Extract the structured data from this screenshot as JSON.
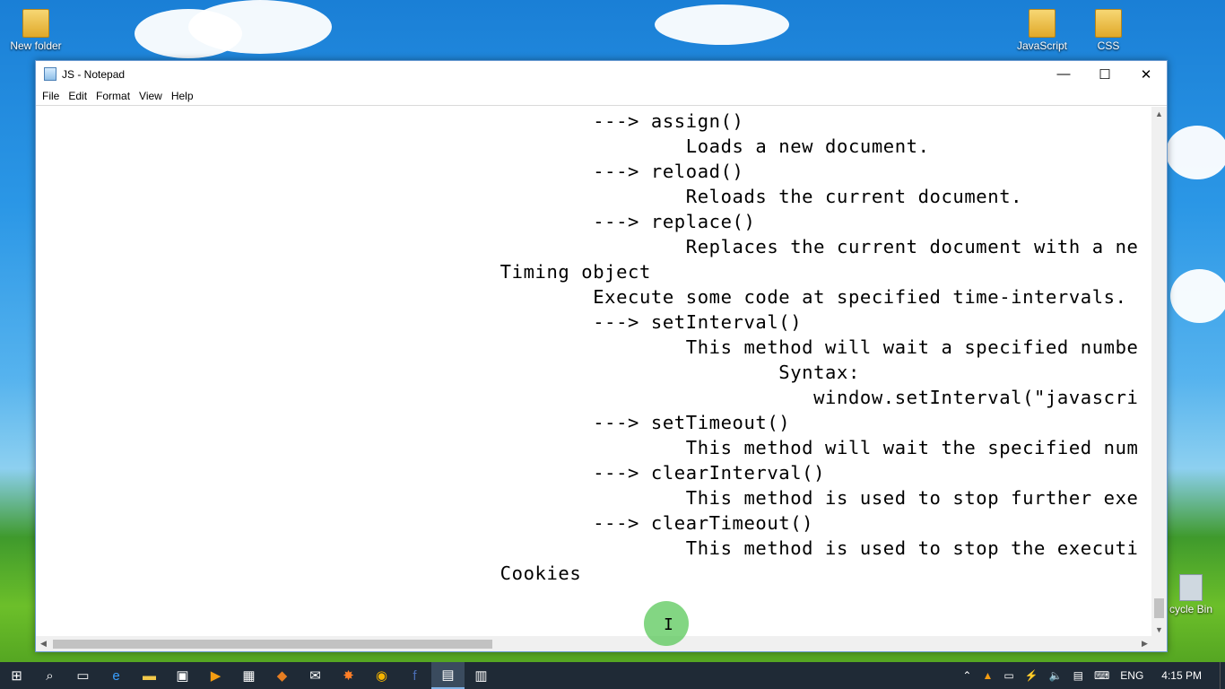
{
  "desktop": {
    "icons": [
      {
        "label": "New folder"
      },
      {
        "label": "JavaScript"
      },
      {
        "label": "CSS"
      },
      {
        "label": "cycle Bin"
      }
    ]
  },
  "window": {
    "title": "JS - Notepad",
    "minimize": "—",
    "maximize": "☐",
    "close": "✕"
  },
  "menu": {
    "file": "File",
    "edit": "Edit",
    "format": "Format",
    "view": "View",
    "help": "Help"
  },
  "editor": {
    "lines": [
      "                                                ---> assign()",
      "                                                        Loads a new document.",
      "                                                ---> reload()",
      "                                                        Reloads the current document.",
      "                                                ---> replace()",
      "                                                        Replaces the current document with a ne",
      "                                        Timing object",
      "                                                Execute some code at specified time-intervals.",
      "                                                ---> setInterval()",
      "                                                        This method will wait a specified numbe",
      "                                                                Syntax:",
      "                                                                   window.setInterval(\"javascri",
      "                                                ---> setTimeout()",
      "                                                        This method will wait the specified num",
      "                                                ---> clearInterval()",
      "                                                        This method is used to stop further exe",
      "                                                ---> clearTimeout()",
      "                                                        This method is used to stop the executi",
      "                                        Cookies"
    ]
  },
  "taskbar": {
    "icons": [
      "windows-logo",
      "search",
      "task-view",
      "edge",
      "file-explorer",
      "store",
      "media-player",
      "film",
      "fox",
      "mail",
      "burst",
      "chrome",
      "facebook",
      "notepad",
      "presentation"
    ],
    "tray": {
      "language": "ENG",
      "time": "4:15 PM"
    }
  }
}
